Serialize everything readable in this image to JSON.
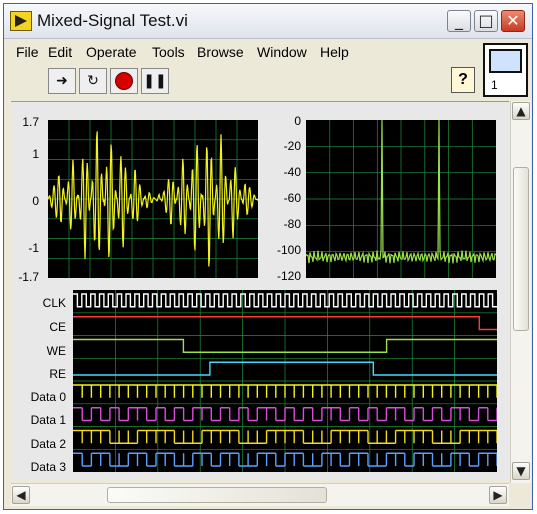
{
  "window": {
    "title": "Mixed-Signal Test.vi",
    "controls": {
      "minimize": "_",
      "maximize": "□",
      "close": "✕"
    }
  },
  "menu": [
    "File",
    "Edit",
    "Operate",
    "Tools",
    "Browse",
    "Window",
    "Help"
  ],
  "toolbar": {
    "buttons": [
      "run-arrow-icon",
      "run-continuously-icon",
      "abort-icon",
      "pause-icon"
    ],
    "help_label": "?"
  },
  "connector": {
    "number": "1"
  },
  "colors": {
    "grid": "#1f8f3a",
    "plot_bg": "#000000",
    "analog_trace": "#f2f21c",
    "spectrum_trace": "#9be14a",
    "clk": "#ffffff",
    "ce": "#ff3a3a",
    "we": "#9be14a",
    "re": "#45d8ff",
    "data0": "#f2f21c",
    "data1": "#d84fd8",
    "data2": "#f2d91c",
    "data3": "#5aa0ff"
  },
  "time_graph": {
    "y_ticks": [
      "1.7",
      "1",
      "0",
      "-1",
      "-1.7"
    ]
  },
  "spectrum_graph": {
    "y_ticks": [
      "0",
      "-20",
      "-40",
      "-60",
      "-80",
      "-100",
      "-120"
    ]
  },
  "digital": {
    "signals": [
      "CLK",
      "CE",
      "WE",
      "RE",
      "Data 0",
      "Data 1",
      "Data 2",
      "Data 3"
    ]
  },
  "chart_data": [
    {
      "type": "line",
      "ylim": [
        -1.7,
        1.7
      ],
      "series": [
        {
          "values": [
            0,
            0.6,
            -0.9,
            1.3,
            -1.6,
            1.5,
            -1.2,
            0.7,
            -0.2,
            0.1,
            -0.6,
            1.0,
            -1.4,
            1.6,
            -1.4,
            0.9,
            -0.4,
            0.05
          ]
        }
      ]
    },
    {
      "type": "line",
      "ylim": [
        -120,
        0
      ],
      "series": [
        {
          "values": [
            -104,
            -106,
            -103,
            -105,
            0,
            -104,
            -106,
            0,
            -103,
            -105,
            -104
          ]
        }
      ]
    }
  ]
}
